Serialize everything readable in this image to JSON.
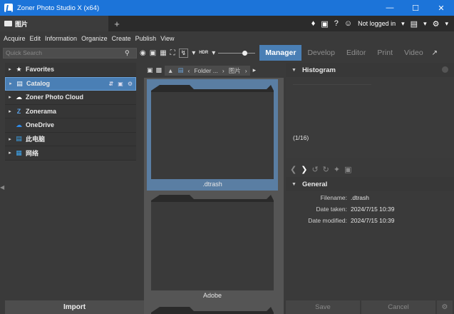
{
  "window": {
    "title": "Zoner Photo Studio X (x64)",
    "controls": [
      "—",
      "☐",
      "✕"
    ]
  },
  "tabbar": {
    "tab_label": "图片",
    "add_label": "+",
    "bell": "🔔",
    "cart": "🛒",
    "help": "?",
    "user_label": "Not logged in",
    "user_caret": "▾",
    "monitor_caret": "▾",
    "menu_caret": "▾"
  },
  "menu": [
    "Acquire",
    "Edit",
    "Information",
    "Organize",
    "Create",
    "Publish",
    "View"
  ],
  "toolbar": {
    "search_placeholder": "Quick Search",
    "hdr_label": "HDR",
    "modes": [
      "Manager",
      "Develop",
      "Editor",
      "Print",
      "Video"
    ],
    "active_mode": "Manager"
  },
  "navigator": {
    "items": [
      {
        "label": "Favorites",
        "icon": "star-icon",
        "expandable": true
      },
      {
        "label": "Catalog",
        "icon": "catalog-icon",
        "expandable": true,
        "selected": true
      },
      {
        "label": "Zoner Photo Cloud",
        "icon": "cloud-icon",
        "expandable": true
      },
      {
        "label": "Zonerama",
        "icon": "zonerama-icon",
        "expandable": true
      },
      {
        "label": "OneDrive",
        "icon": "onedrive-icon",
        "expandable": false
      },
      {
        "label": "此电脑",
        "icon": "computer-icon",
        "expandable": true
      },
      {
        "label": "网络",
        "icon": "network-icon",
        "expandable": true
      }
    ],
    "import_label": "Import"
  },
  "browser": {
    "breadcrumb": [
      "Folder ...",
      "图片"
    ],
    "items": [
      {
        "label": ".dtrash",
        "selected": true
      },
      {
        "label": "Adobe",
        "selected": false
      }
    ]
  },
  "histogram": {
    "title": "Histogram",
    "count": "(1/16)"
  },
  "general": {
    "title": "General",
    "rows": [
      {
        "key": "Filename:",
        "value": ".dtrash"
      },
      {
        "key": "Date taken:",
        "value": "2024/7/15 10:39"
      },
      {
        "key": "Date modified:",
        "value": "2024/7/15 10:39"
      }
    ]
  },
  "actions": {
    "save_label": "Save",
    "cancel_label": "Cancel"
  }
}
